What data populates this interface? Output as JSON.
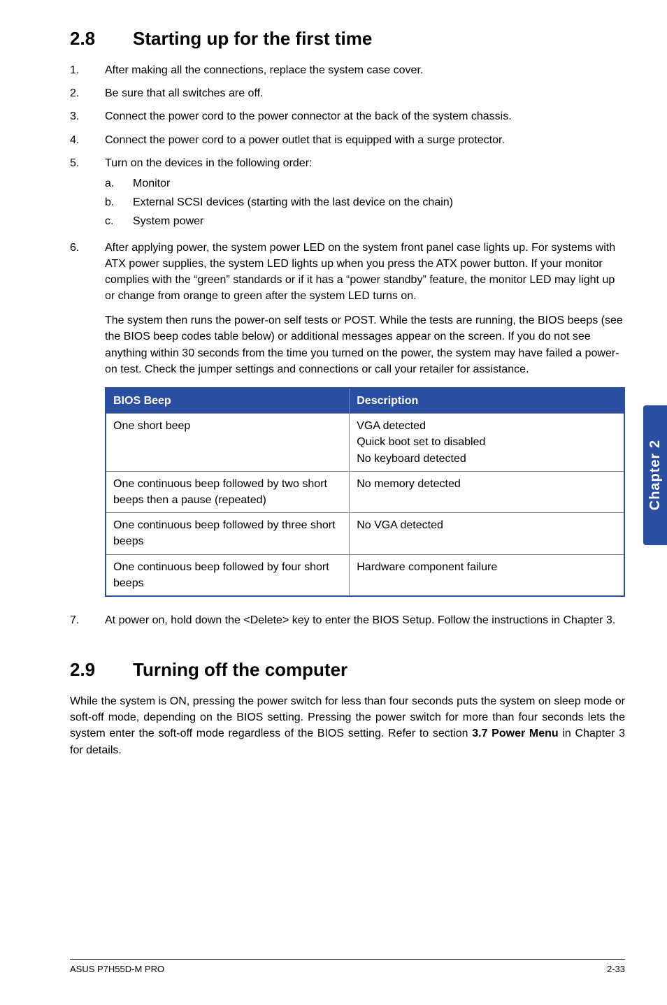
{
  "section1": {
    "number": "2.8",
    "title": "Starting up for the first time",
    "items": [
      {
        "n": "1.",
        "text": "After making all the connections, replace the system case cover."
      },
      {
        "n": "2.",
        "text": "Be sure that all switches are off."
      },
      {
        "n": "3.",
        "text": "Connect the power cord to the power connector at the back of the system chassis."
      },
      {
        "n": "4.",
        "text": "Connect the power cord to a power outlet that is equipped with a surge protector."
      },
      {
        "n": "5.",
        "text": "Turn on the devices in the following order:",
        "sub": [
          {
            "m": "a.",
            "t": "Monitor"
          },
          {
            "m": "b.",
            "t": "External SCSI devices (starting with the last device on the chain)"
          },
          {
            "m": "c.",
            "t": "System power"
          }
        ]
      },
      {
        "n": "6.",
        "text": "After applying power, the system power LED on the system front panel case lights up. For systems with ATX power supplies, the system LED lights up when you press the ATX power button. If your monitor complies with the “green” standards or if it has a “power standby” feature, the monitor LED may light up or change from orange to green after the system LED turns on.",
        "para2": "The system then runs the power-on self tests or POST. While the tests are running, the BIOS beeps (see the BIOS beep codes table below) or additional messages appear on the screen. If you do not see anything within 30 seconds from the time you turned on the power, the system may have failed a power-on test. Check the jumper settings and connections or call your retailer for assistance."
      }
    ],
    "table": {
      "headers": [
        "BIOS Beep",
        "Description"
      ],
      "rows": [
        [
          "One short beep",
          "VGA detected\nQuick boot set to disabled\nNo keyboard detected"
        ],
        [
          "One continuous beep followed by two short beeps then a pause (repeated)",
          "No memory detected"
        ],
        [
          "One continuous beep followed by three short beeps",
          "No VGA detected"
        ],
        [
          "One continuous beep followed by four short beeps",
          "Hardware component failure"
        ]
      ]
    },
    "item7": {
      "n": "7.",
      "text": "At power on, hold down the <Delete> key to enter the BIOS Setup. Follow the instructions in Chapter 3."
    }
  },
  "section2": {
    "number": "2.9",
    "title": "Turning off the computer",
    "body_pre": "While the system is ON, pressing the power switch for less than four seconds puts the system on sleep mode or soft-off mode, depending on the BIOS setting. Pressing the power switch for more than four seconds lets the system enter the soft-off mode regardless of the BIOS setting. Refer to section ",
    "body_bold": "3.7 Power Menu",
    "body_post": " in Chapter 3 for details."
  },
  "sidetab": "Chapter 2",
  "footer": {
    "left": "ASUS P7H55D-M PRO",
    "right": "2-33"
  }
}
